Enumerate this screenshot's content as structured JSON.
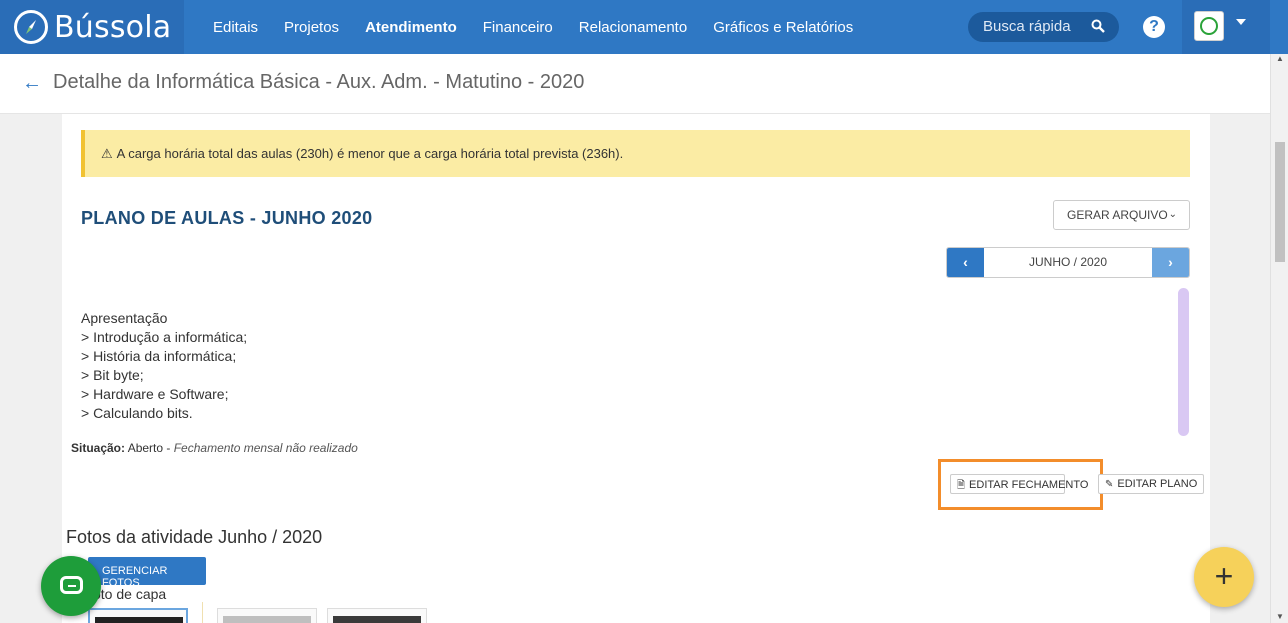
{
  "app": {
    "name": "Bússola"
  },
  "nav": {
    "items": [
      {
        "label": "Editais"
      },
      {
        "label": "Projetos"
      },
      {
        "label": "Atendimento"
      },
      {
        "label": "Financeiro"
      },
      {
        "label": "Relacionamento"
      },
      {
        "label": "Gráficos e Relatórios"
      }
    ],
    "active": "Atendimento",
    "search_placeholder": "Busca rápida",
    "help_label": "?"
  },
  "page": {
    "title": "Detalhe da Informática Básica - Aux. Adm. - Matutino - 2020"
  },
  "alert": {
    "text": "A carga horária total das aulas (230h) é menor que a carga horária total prevista (236h)."
  },
  "plan": {
    "title": "PLANO DE AULAS - JUNHO 2020",
    "generate_label": "GERAR ARQUIVO",
    "month_label": "JUNHO / 2020",
    "lesson_lines": [
      "Apresentação",
      "> Introdução a informática;",
      "> História da informática;",
      "> Bit byte;",
      "> Hardware e Software;",
      "> Calculando bits."
    ],
    "status_label": "Situação:",
    "status_value": "Aberto -",
    "status_note": "Fechamento mensal não realizado",
    "edit_closing_label": "EDITAR FECHAMENTO",
    "edit_plan_label": "EDITAR PLANO"
  },
  "photos": {
    "title": "Fotos da atividade Junho / 2020",
    "manage_label": "GERENCIAR FOTOS",
    "cover_label": "oto de capa"
  },
  "colors": {
    "brand_blue": "#2f78c4",
    "alert_bg": "#fbeca4",
    "highlight_orange": "#f38d2b",
    "chat_green": "#1e9d3a",
    "fab_yellow": "#f6d15a"
  }
}
